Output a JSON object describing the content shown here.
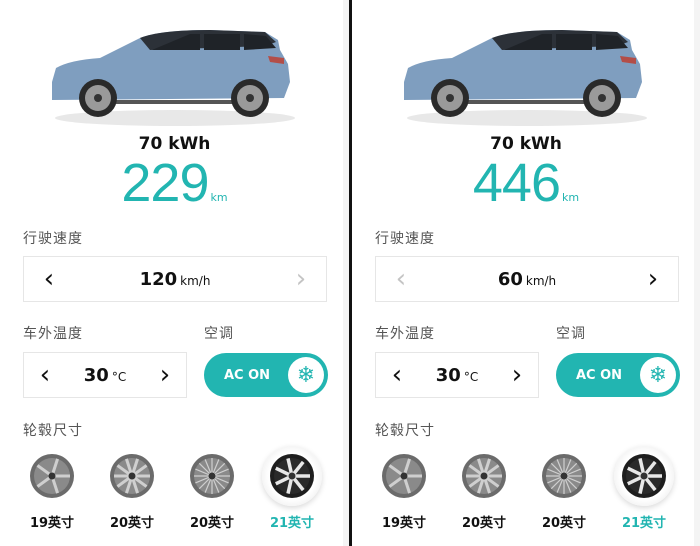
{
  "colors": {
    "accent": "#22b5b1",
    "text": "#111111",
    "muted": "#555555",
    "disabled_arrow": "#c4c4c4"
  },
  "panels": [
    {
      "battery": "70 kWh",
      "range_value": "229",
      "range_unit": "km",
      "speed": {
        "label": "行驶速度",
        "value": "120",
        "unit": "km/h",
        "prev_icon": "chevron-left",
        "next_icon": "chevron-right",
        "prev_enabled": true,
        "next_enabled": false
      },
      "temperature": {
        "label": "车外温度",
        "value": "30",
        "unit": "°C"
      },
      "ac": {
        "label": "空调",
        "state_text": "AC ON",
        "icon": "snowflake"
      },
      "wheel_section": {
        "label": "轮毂尺寸"
      },
      "wheels": [
        {
          "name": "19英寸",
          "selected": false
        },
        {
          "name": "20英寸",
          "selected": false
        },
        {
          "name": "20英寸",
          "selected": false
        },
        {
          "name": "21英寸",
          "selected": true
        }
      ]
    },
    {
      "battery": "70 kWh",
      "range_value": "446",
      "range_unit": "km",
      "speed": {
        "label": "行驶速度",
        "value": "60",
        "unit": "km/h",
        "prev_icon": "chevron-left",
        "next_icon": "chevron-right",
        "prev_enabled": false,
        "next_enabled": true
      },
      "temperature": {
        "label": "车外温度",
        "value": "30",
        "unit": "°C"
      },
      "ac": {
        "label": "空调",
        "state_text": "AC ON",
        "icon": "snowflake"
      },
      "wheel_section": {
        "label": "轮毂尺寸"
      },
      "wheels": [
        {
          "name": "19英寸",
          "selected": false
        },
        {
          "name": "20英寸",
          "selected": false
        },
        {
          "name": "20英寸",
          "selected": false
        },
        {
          "name": "21英寸",
          "selected": true
        }
      ]
    }
  ],
  "icons": {
    "prev": "‹",
    "next": "›",
    "snowflake": "❄"
  }
}
